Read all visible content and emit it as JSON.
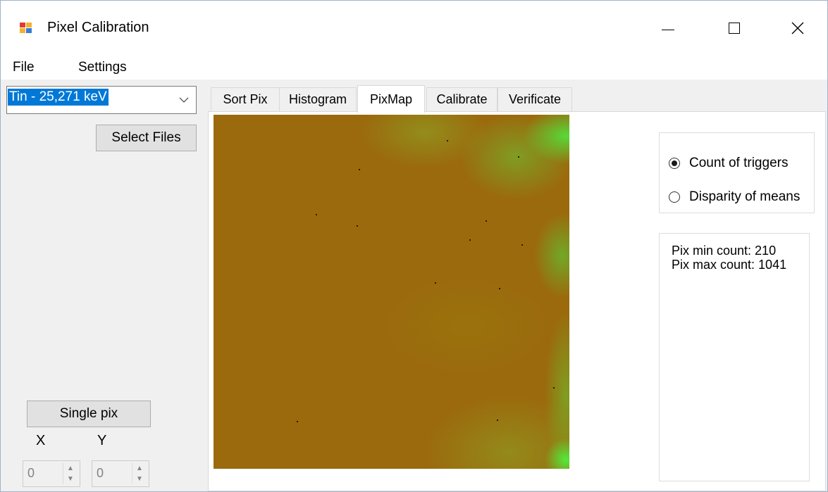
{
  "window": {
    "title": "Pixel Calibration"
  },
  "caption_buttons": {
    "minimize": "—",
    "maximize": "☐",
    "close": "✕"
  },
  "menu": {
    "items": [
      "File",
      "Settings"
    ]
  },
  "source_combo": {
    "value": "Tin - 25,271 keV"
  },
  "select_files_button": "Select Files",
  "single_pix_button": "Single pix",
  "coords": {
    "x_label": "X",
    "y_label": "Y",
    "x_value": "0",
    "y_value": "0"
  },
  "tabs": [
    "Sort Pix",
    "Histogram",
    "PixMap",
    "Calibrate",
    "Verificate"
  ],
  "active_tab": "PixMap",
  "mode": {
    "options": [
      "Count of triggers",
      "Disparity of means"
    ],
    "selected": "Count of triggers"
  },
  "stats": {
    "min_line": "Pix min count: 210",
    "max_line": "Pix max count: 1041"
  },
  "colors": {
    "map_base": "#9b6a0d",
    "map_hot": "#50e63c",
    "selection": "#0078d7"
  }
}
